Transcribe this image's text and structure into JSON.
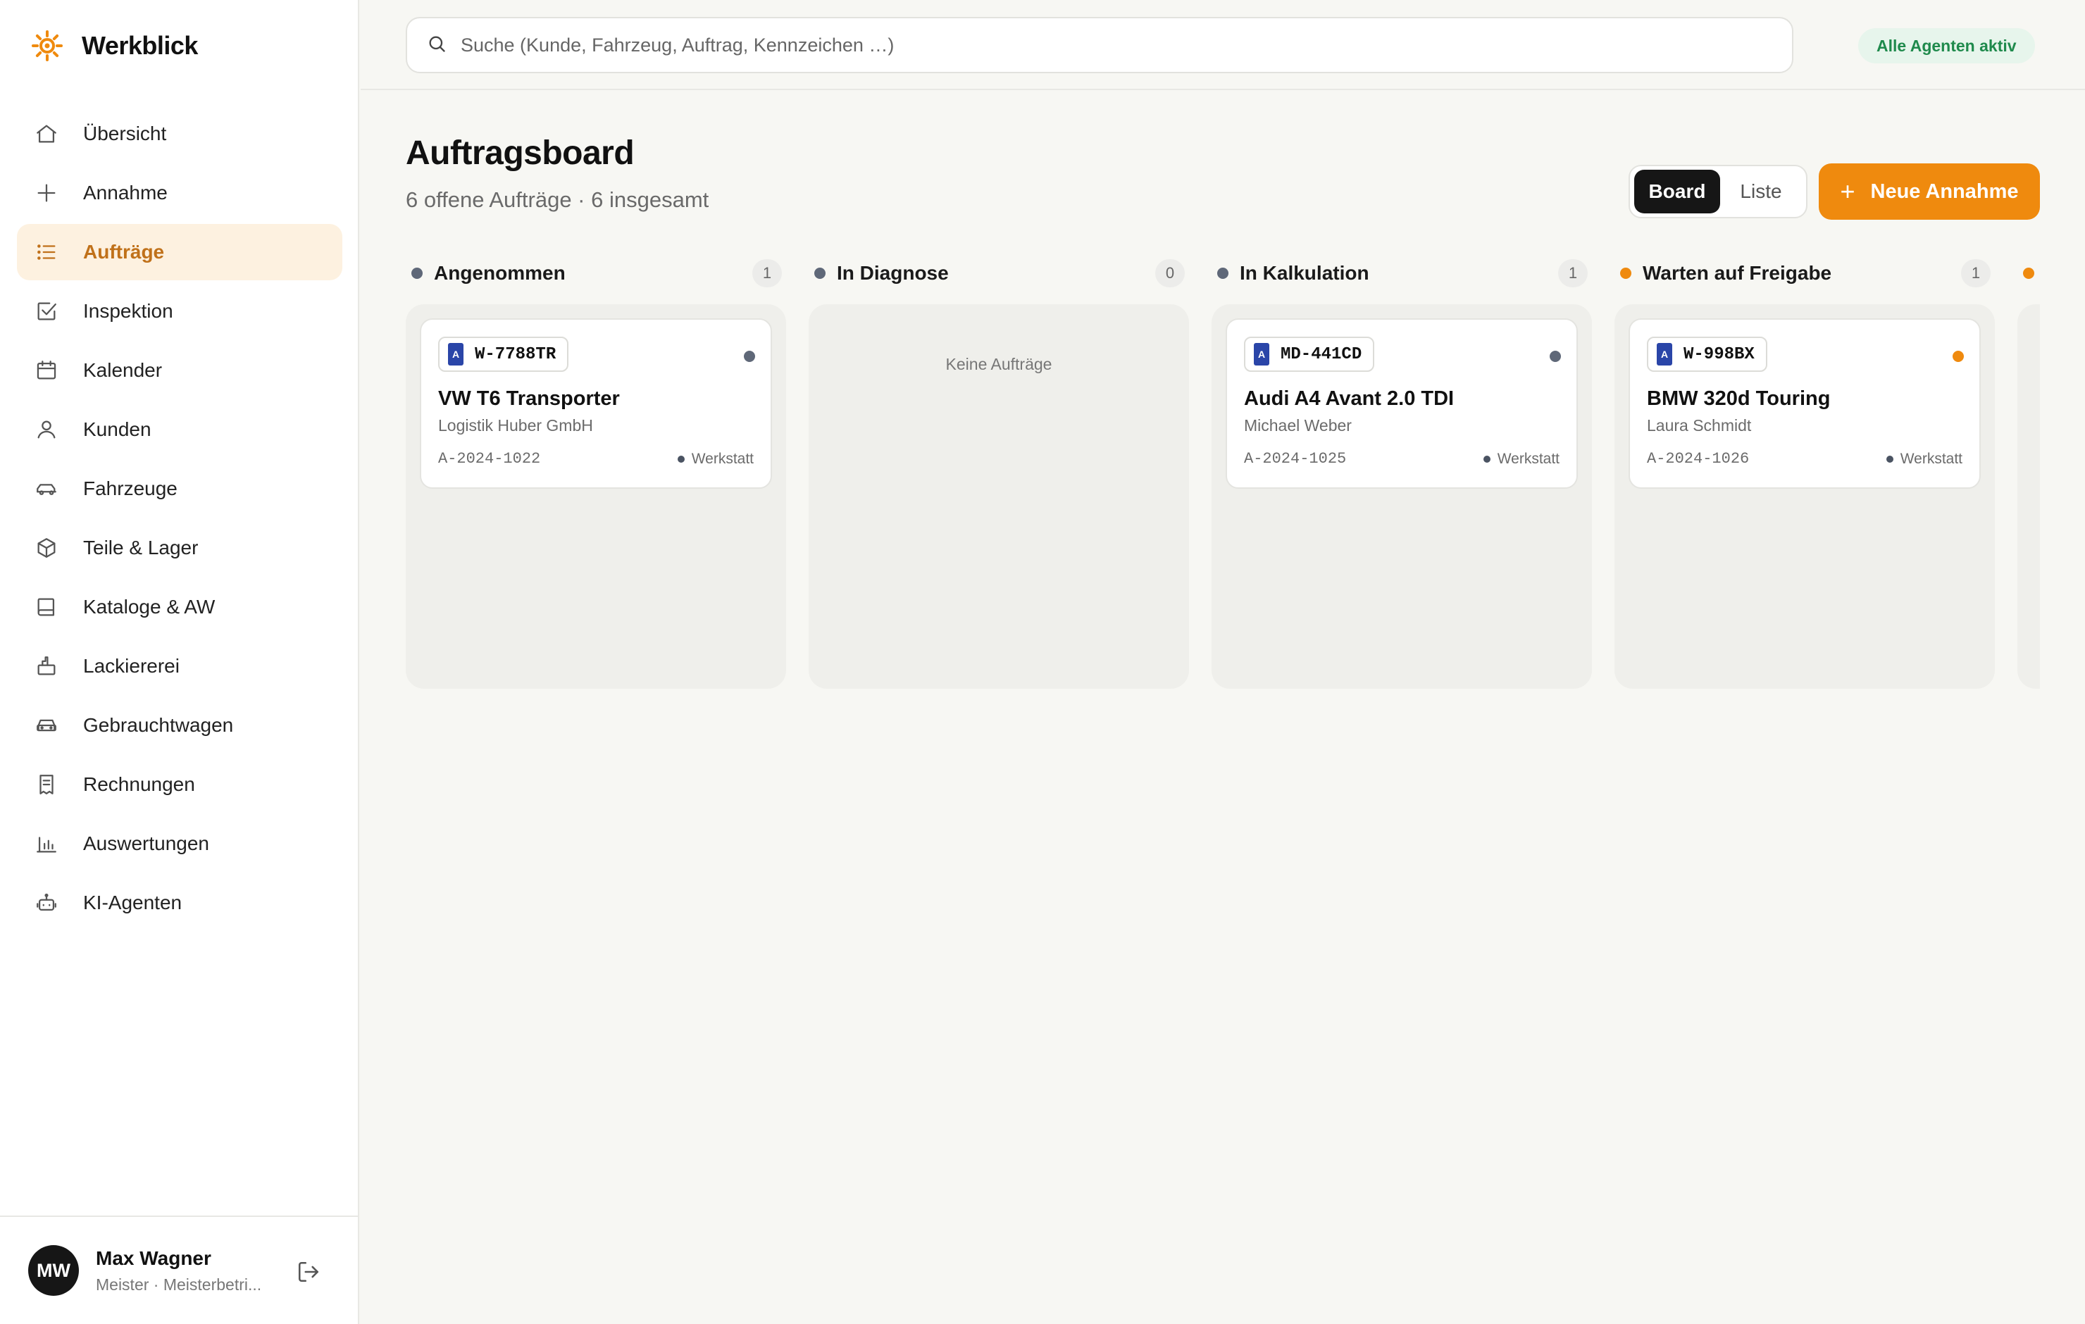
{
  "app": {
    "name": "Werkblick"
  },
  "sidebar": {
    "items": [
      {
        "label": "Übersicht",
        "icon": "home-icon"
      },
      {
        "label": "Annahme",
        "icon": "plus-icon"
      },
      {
        "label": "Aufträge",
        "icon": "list-icon",
        "active": true
      },
      {
        "label": "Inspektion",
        "icon": "checkbox-icon"
      },
      {
        "label": "Kalender",
        "icon": "calendar-icon"
      },
      {
        "label": "Kunden",
        "icon": "user-icon"
      },
      {
        "label": "Fahrzeuge",
        "icon": "car-side-icon"
      },
      {
        "label": "Teile & Lager",
        "icon": "box-icon"
      },
      {
        "label": "Kataloge & AW",
        "icon": "book-icon"
      },
      {
        "label": "Lackiererei",
        "icon": "paint-icon"
      },
      {
        "label": "Gebrauchtwagen",
        "icon": "car-icon"
      },
      {
        "label": "Rechnungen",
        "icon": "receipt-icon"
      },
      {
        "label": "Auswertungen",
        "icon": "bar-chart-icon"
      },
      {
        "label": "KI-Agenten",
        "icon": "robot-icon"
      }
    ]
  },
  "user": {
    "initials": "MW",
    "name": "Max Wagner",
    "role": "Meister · Meisterbetri..."
  },
  "search": {
    "placeholder": "Suche (Kunde, Fahrzeug, Auftrag, Kennzeichen …)"
  },
  "agents_status": "Alle Agenten aktiv",
  "page": {
    "title": "Auftragsboard",
    "subtitle": "6 offene Aufträge · 6 insgesamt"
  },
  "view_toggle": {
    "board": "Board",
    "list": "Liste"
  },
  "new_button": "Neue Annahme",
  "colors": {
    "accent": "#ef8a0e",
    "status_gray": "#5f6878",
    "status_orange": "#ef8a0e",
    "agents_green": "#1f8a4c"
  },
  "columns": [
    {
      "name": "Angenommen",
      "count": "1",
      "dot": "#5f6878",
      "cards": [
        {
          "plate_eu": "A",
          "plate": "W-7788TR",
          "vehicle": "VW T6 Transporter",
          "customer": "Logistik Huber GmbH",
          "order": "A-2024-1022",
          "location": "Werkstatt",
          "dot": "#5f6878"
        }
      ]
    },
    {
      "name": "In Diagnose",
      "count": "0",
      "dot": "#5f6878",
      "empty": "Keine Aufträge",
      "cards": []
    },
    {
      "name": "In Kalkulation",
      "count": "1",
      "dot": "#5f6878",
      "cards": [
        {
          "plate_eu": "A",
          "plate": "MD-441CD",
          "vehicle": "Audi A4 Avant 2.0 TDI",
          "customer": "Michael Weber",
          "order": "A-2024-1025",
          "location": "Werkstatt",
          "dot": "#5f6878"
        }
      ]
    },
    {
      "name": "Warten auf Freigabe",
      "count": "1",
      "dot": "#ef8a0e",
      "cards": [
        {
          "plate_eu": "A",
          "plate": "W-998BX",
          "vehicle": "BMW 320d Touring",
          "customer": "Laura Schmidt",
          "order": "A-2024-1026",
          "location": "Werkstatt",
          "dot": "#ef8a0e"
        }
      ]
    },
    {
      "name": "",
      "count": "",
      "dot": "#ef8a0e",
      "cards": []
    }
  ]
}
